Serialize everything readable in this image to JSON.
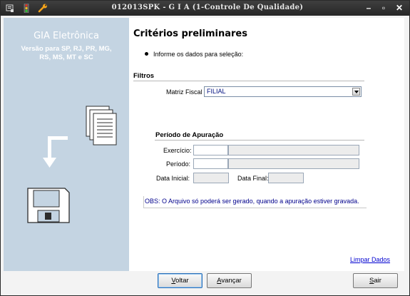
{
  "window": {
    "title": "012013SPK - G I A (1-Controle De Qualidade)",
    "controls": [
      "minimize",
      "maximize",
      "close"
    ]
  },
  "sidebar": {
    "title": "GIA Eletrônica",
    "subtitle_lines": [
      "Versão para SP, RJ, PR, MG,",
      "RS, MS, MT e SC"
    ],
    "background": "#c4d4e2"
  },
  "main": {
    "heading": "Critérios preliminares",
    "instruction": "Informe os dados para seleção:",
    "filtros": {
      "title": "Filtros",
      "matriz_label": "Matriz Fiscal :",
      "matriz_value": "FILIAL"
    },
    "periodo": {
      "title": "Período de Apuração",
      "exercicio_label": "Exercício:",
      "periodo_label": "Período:",
      "data_inicial_label": "Data Inicial:",
      "data_final_label": "Data Final:"
    },
    "obs": "OBS: O Arquivo só poderá ser gerado, quando a apuração estiver gravada.",
    "limpar_link": "Limpar Dados"
  },
  "footer": {
    "back": {
      "prefix": "",
      "accel": "V",
      "rest": "oltar"
    },
    "next": {
      "prefix": "",
      "accel": "A",
      "rest": "vançar"
    },
    "exit": {
      "prefix": "",
      "accel": "S",
      "rest": "air"
    }
  }
}
